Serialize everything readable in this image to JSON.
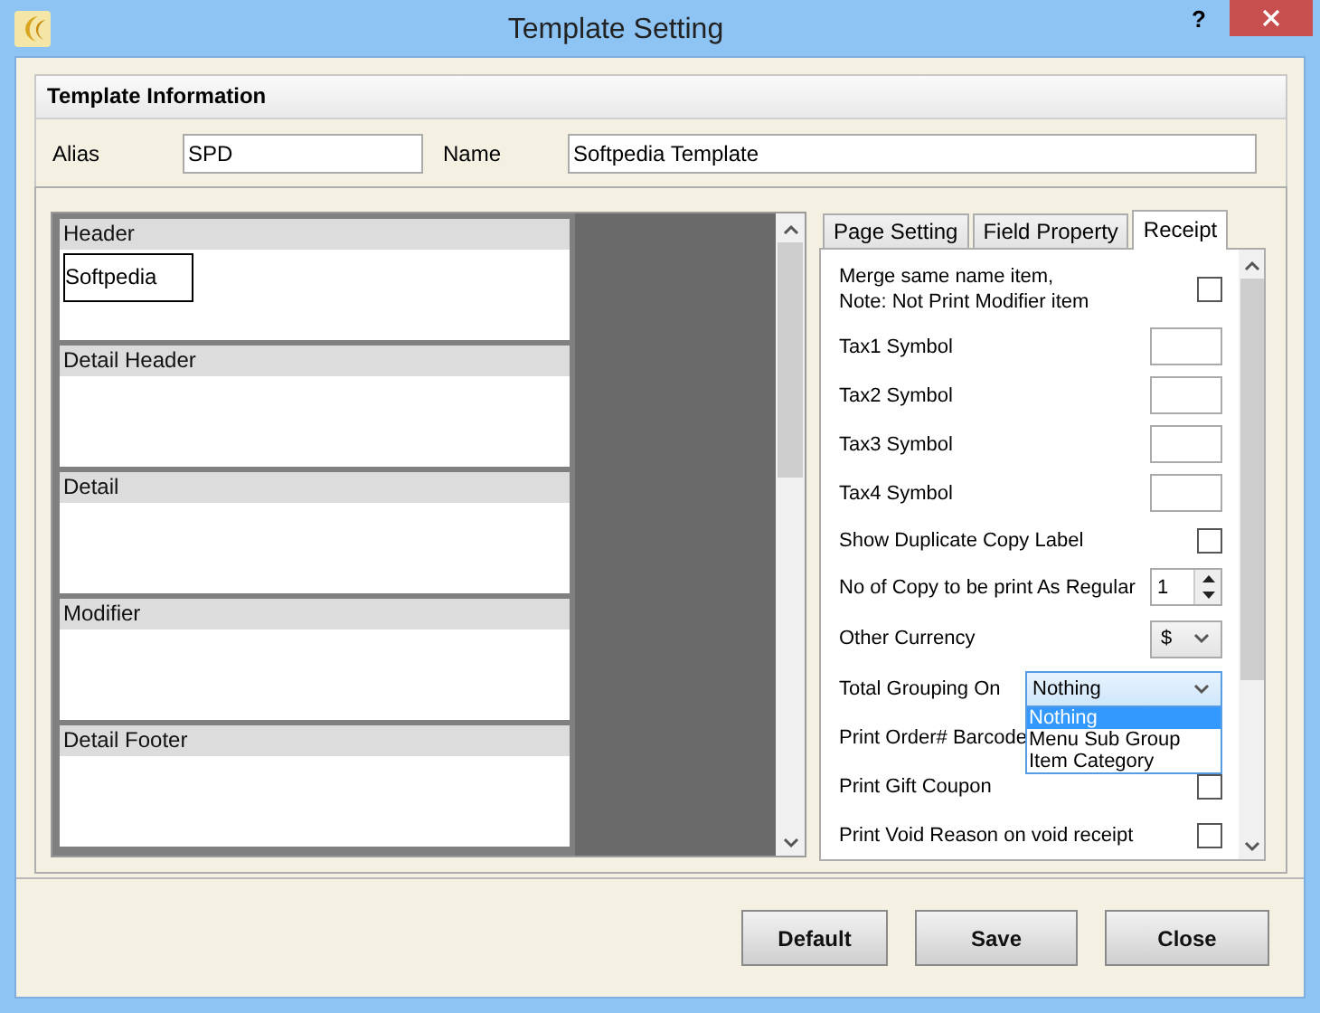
{
  "window": {
    "title": "Template Setting",
    "help": "?"
  },
  "template_information": {
    "title": "Template Information",
    "fields": [
      {
        "label": "Alias",
        "value": "SPD"
      },
      {
        "label": "Name",
        "value": "Softpedia Template"
      }
    ]
  },
  "designer": {
    "sections": [
      {
        "title": "Header",
        "items": [
          "Softpedia"
        ]
      },
      {
        "title": "Detail Header"
      },
      {
        "title": "Detail"
      },
      {
        "title": "Modifier"
      },
      {
        "title": "Detail Footer"
      }
    ]
  },
  "tabs": [
    {
      "label": "Page Setting",
      "selected": false
    },
    {
      "label": "Field Property",
      "selected": false
    },
    {
      "label": "Receipt",
      "selected": true
    }
  ],
  "receipt_rows": [
    {
      "kind": "checkbox",
      "label": "Merge same name item,\nNote: Not Print Modifier item",
      "checked": false
    },
    {
      "kind": "text",
      "label": "Tax1 Symbol"
    },
    {
      "kind": "text",
      "label": "Tax2 Symbol"
    },
    {
      "kind": "text",
      "label": "Tax3 Symbol"
    },
    {
      "kind": "text",
      "label": "Tax4 Symbol"
    },
    {
      "kind": "checkbox",
      "label": "Show Duplicate Copy Label",
      "checked": false
    },
    {
      "kind": "spinner",
      "label": "No of Copy to be print As Regular",
      "value": "1"
    },
    {
      "kind": "select",
      "label": "Other Currency",
      "value": "$",
      "open": false
    },
    {
      "kind": "select",
      "label": "Total Grouping On",
      "value": "Nothing",
      "open": true,
      "options": [
        {
          "label": "Nothing",
          "selected": true
        },
        {
          "label": "Menu Sub Group",
          "selected": false
        },
        {
          "label": "Item Category",
          "selected": false
        }
      ]
    },
    {
      "kind": "label",
      "label": "Print Order# Barcode"
    },
    {
      "kind": "checkbox",
      "label": "Print Gift Coupon",
      "checked": false
    },
    {
      "kind": "checkbox",
      "label": "Print Void Reason on void receipt",
      "checked": false
    }
  ],
  "buttons": [
    "Default",
    "Save",
    "Close"
  ]
}
